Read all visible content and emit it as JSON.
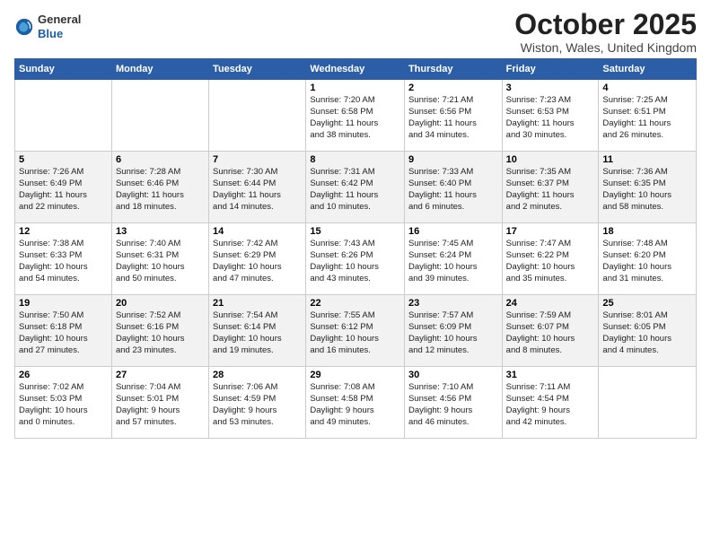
{
  "header": {
    "logo": {
      "general": "General",
      "blue": "Blue"
    },
    "title": "October 2025",
    "location": "Wiston, Wales, United Kingdom"
  },
  "weekdays": [
    "Sunday",
    "Monday",
    "Tuesday",
    "Wednesday",
    "Thursday",
    "Friday",
    "Saturday"
  ],
  "weeks": [
    [
      {
        "day": "",
        "content": ""
      },
      {
        "day": "",
        "content": ""
      },
      {
        "day": "",
        "content": ""
      },
      {
        "day": "1",
        "content": "Sunrise: 7:20 AM\nSunset: 6:58 PM\nDaylight: 11 hours\nand 38 minutes."
      },
      {
        "day": "2",
        "content": "Sunrise: 7:21 AM\nSunset: 6:56 PM\nDaylight: 11 hours\nand 34 minutes."
      },
      {
        "day": "3",
        "content": "Sunrise: 7:23 AM\nSunset: 6:53 PM\nDaylight: 11 hours\nand 30 minutes."
      },
      {
        "day": "4",
        "content": "Sunrise: 7:25 AM\nSunset: 6:51 PM\nDaylight: 11 hours\nand 26 minutes."
      }
    ],
    [
      {
        "day": "5",
        "content": "Sunrise: 7:26 AM\nSunset: 6:49 PM\nDaylight: 11 hours\nand 22 minutes."
      },
      {
        "day": "6",
        "content": "Sunrise: 7:28 AM\nSunset: 6:46 PM\nDaylight: 11 hours\nand 18 minutes."
      },
      {
        "day": "7",
        "content": "Sunrise: 7:30 AM\nSunset: 6:44 PM\nDaylight: 11 hours\nand 14 minutes."
      },
      {
        "day": "8",
        "content": "Sunrise: 7:31 AM\nSunset: 6:42 PM\nDaylight: 11 hours\nand 10 minutes."
      },
      {
        "day": "9",
        "content": "Sunrise: 7:33 AM\nSunset: 6:40 PM\nDaylight: 11 hours\nand 6 minutes."
      },
      {
        "day": "10",
        "content": "Sunrise: 7:35 AM\nSunset: 6:37 PM\nDaylight: 11 hours\nand 2 minutes."
      },
      {
        "day": "11",
        "content": "Sunrise: 7:36 AM\nSunset: 6:35 PM\nDaylight: 10 hours\nand 58 minutes."
      }
    ],
    [
      {
        "day": "12",
        "content": "Sunrise: 7:38 AM\nSunset: 6:33 PM\nDaylight: 10 hours\nand 54 minutes."
      },
      {
        "day": "13",
        "content": "Sunrise: 7:40 AM\nSunset: 6:31 PM\nDaylight: 10 hours\nand 50 minutes."
      },
      {
        "day": "14",
        "content": "Sunrise: 7:42 AM\nSunset: 6:29 PM\nDaylight: 10 hours\nand 47 minutes."
      },
      {
        "day": "15",
        "content": "Sunrise: 7:43 AM\nSunset: 6:26 PM\nDaylight: 10 hours\nand 43 minutes."
      },
      {
        "day": "16",
        "content": "Sunrise: 7:45 AM\nSunset: 6:24 PM\nDaylight: 10 hours\nand 39 minutes."
      },
      {
        "day": "17",
        "content": "Sunrise: 7:47 AM\nSunset: 6:22 PM\nDaylight: 10 hours\nand 35 minutes."
      },
      {
        "day": "18",
        "content": "Sunrise: 7:48 AM\nSunset: 6:20 PM\nDaylight: 10 hours\nand 31 minutes."
      }
    ],
    [
      {
        "day": "19",
        "content": "Sunrise: 7:50 AM\nSunset: 6:18 PM\nDaylight: 10 hours\nand 27 minutes."
      },
      {
        "day": "20",
        "content": "Sunrise: 7:52 AM\nSunset: 6:16 PM\nDaylight: 10 hours\nand 23 minutes."
      },
      {
        "day": "21",
        "content": "Sunrise: 7:54 AM\nSunset: 6:14 PM\nDaylight: 10 hours\nand 19 minutes."
      },
      {
        "day": "22",
        "content": "Sunrise: 7:55 AM\nSunset: 6:12 PM\nDaylight: 10 hours\nand 16 minutes."
      },
      {
        "day": "23",
        "content": "Sunrise: 7:57 AM\nSunset: 6:09 PM\nDaylight: 10 hours\nand 12 minutes."
      },
      {
        "day": "24",
        "content": "Sunrise: 7:59 AM\nSunset: 6:07 PM\nDaylight: 10 hours\nand 8 minutes."
      },
      {
        "day": "25",
        "content": "Sunrise: 8:01 AM\nSunset: 6:05 PM\nDaylight: 10 hours\nand 4 minutes."
      }
    ],
    [
      {
        "day": "26",
        "content": "Sunrise: 7:02 AM\nSunset: 5:03 PM\nDaylight: 10 hours\nand 0 minutes."
      },
      {
        "day": "27",
        "content": "Sunrise: 7:04 AM\nSunset: 5:01 PM\nDaylight: 9 hours\nand 57 minutes."
      },
      {
        "day": "28",
        "content": "Sunrise: 7:06 AM\nSunset: 4:59 PM\nDaylight: 9 hours\nand 53 minutes."
      },
      {
        "day": "29",
        "content": "Sunrise: 7:08 AM\nSunset: 4:58 PM\nDaylight: 9 hours\nand 49 minutes."
      },
      {
        "day": "30",
        "content": "Sunrise: 7:10 AM\nSunset: 4:56 PM\nDaylight: 9 hours\nand 46 minutes."
      },
      {
        "day": "31",
        "content": "Sunrise: 7:11 AM\nSunset: 4:54 PM\nDaylight: 9 hours\nand 42 minutes."
      },
      {
        "day": "",
        "content": ""
      }
    ]
  ],
  "row_styles": [
    "row-white",
    "row-shaded",
    "row-white",
    "row-shaded",
    "row-white"
  ]
}
